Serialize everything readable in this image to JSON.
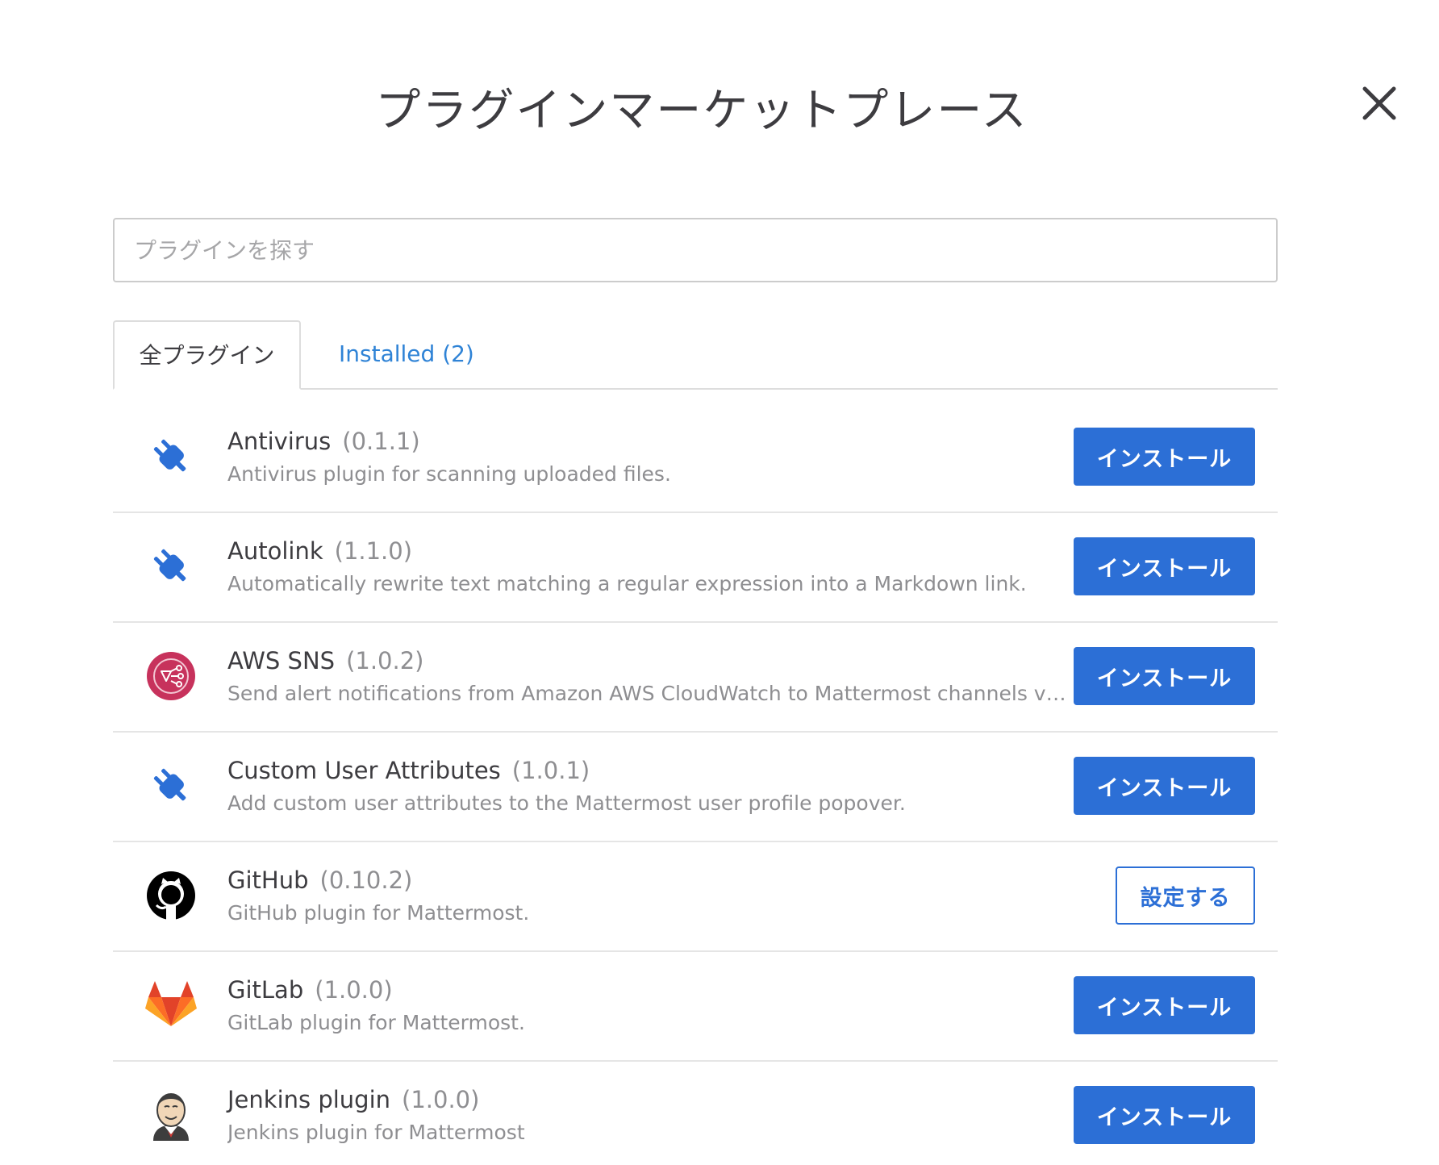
{
  "modal": {
    "title": "プラグインマーケットプレース",
    "close_icon": "close-icon"
  },
  "search": {
    "placeholder": "プラグインを探す",
    "value": ""
  },
  "tabs": [
    {
      "label": "全プラグイン",
      "active": true
    },
    {
      "label": "Installed (2)",
      "active": false
    }
  ],
  "colors": {
    "accent": "#2c6fd6",
    "link": "#2f83d6",
    "text": "#3d3c40",
    "muted": "#8e8e91"
  },
  "plugins": [
    {
      "name": "Antivirus",
      "version": "(0.1.1)",
      "description": "Antivirus plugin for scanning uploaded files.",
      "icon": "plug-icon",
      "action": "インストール",
      "action_type": "install"
    },
    {
      "name": "Autolink",
      "version": "(1.1.0)",
      "description": "Automatically rewrite text matching a regular expression into a Markdown link.",
      "icon": "plug-icon",
      "action": "インストール",
      "action_type": "install"
    },
    {
      "name": "AWS SNS",
      "version": "(1.0.2)",
      "description": "Send alert notifications from Amazon AWS CloudWatch to Mattermost channels via ...",
      "icon": "aws-sns-icon",
      "action": "インストール",
      "action_type": "install"
    },
    {
      "name": "Custom User Attributes",
      "version": "(1.0.1)",
      "description": "Add custom user attributes to the Mattermost user profile popover.",
      "icon": "plug-icon",
      "action": "インストール",
      "action_type": "install"
    },
    {
      "name": "GitHub",
      "version": "(0.10.2)",
      "description": "GitHub plugin for Mattermost.",
      "icon": "github-icon",
      "action": "設定する",
      "action_type": "configure"
    },
    {
      "name": "GitLab",
      "version": "(1.0.0)",
      "description": "GitLab plugin for Mattermost.",
      "icon": "gitlab-icon",
      "action": "インストール",
      "action_type": "install"
    },
    {
      "name": "Jenkins plugin",
      "version": "(1.0.0)",
      "description": "Jenkins plugin for Mattermost",
      "icon": "jenkins-icon",
      "action": "インストール",
      "action_type": "install"
    }
  ]
}
